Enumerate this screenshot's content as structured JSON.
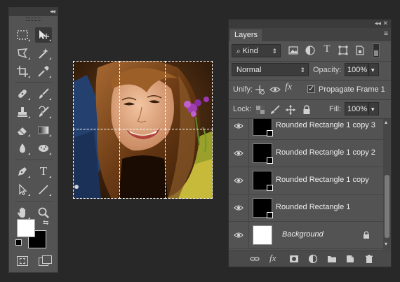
{
  "tools_panel": {
    "collapse_glyph": "◂◂",
    "close_glyph": "✕",
    "tools": [
      {
        "name": "rectangular-marquee-tool"
      },
      {
        "name": "move-tool"
      },
      {
        "name": "polygonal-lasso-tool"
      },
      {
        "name": "magic-wand-tool"
      },
      {
        "name": "crop-tool"
      },
      {
        "name": "eyedropper-tool"
      },
      {
        "name": "spot-healing-brush-tool"
      },
      {
        "name": "brush-tool"
      },
      {
        "name": "clone-stamp-tool"
      },
      {
        "name": "history-brush-tool"
      },
      {
        "name": "eraser-tool"
      },
      {
        "name": "gradient-tool"
      },
      {
        "name": "blur-tool"
      },
      {
        "name": "dodge-tool"
      },
      {
        "name": "pen-tool"
      },
      {
        "name": "type-tool",
        "glyph": "T"
      },
      {
        "name": "path-selection-tool"
      },
      {
        "name": "line-tool"
      },
      {
        "name": "hand-tool"
      },
      {
        "name": "zoom-tool"
      }
    ],
    "foreground_color": "#ffffff",
    "background_color": "#000000"
  },
  "layers_panel": {
    "title": "Layers",
    "collapse_glyph": "◂◂",
    "close_glyph": "✕",
    "menu_glyph": "≡",
    "filter_kind": {
      "icon": "search-icon",
      "value": "Kind",
      "arrows": "⇕"
    },
    "filter_type_glyph": "T",
    "blend_mode": {
      "value": "Normal",
      "arrows": "⇕"
    },
    "opacity": {
      "label": "Opacity:",
      "value": "100%",
      "arrow": "▾"
    },
    "unify_label": "Unify:",
    "fx_glyph": "fx",
    "propagate_frame": {
      "label": "Propagate Frame 1",
      "checked": true
    },
    "lock_label": "Lock:",
    "fill": {
      "label": "Fill:",
      "value": "100%",
      "arrow": "▾"
    },
    "layers": [
      {
        "name": "Rounded Rectangle 1 copy 3",
        "kind": "shape"
      },
      {
        "name": "Rounded Rectangle 1 copy 2",
        "kind": "shape"
      },
      {
        "name": "Rounded Rectangle 1 copy",
        "kind": "shape"
      },
      {
        "name": "Rounded Rectangle 1",
        "kind": "shape"
      },
      {
        "name": "Background",
        "kind": "background",
        "locked": true
      }
    ],
    "footer_fx_glyph": "fx",
    "scroll_up_glyph": "▴",
    "scroll_down_glyph": "▾"
  },
  "colors": {
    "panel_bg": "#535353",
    "app_bg": "#282828",
    "selected_tool_bg": "#383838",
    "field_bg": "#3c3c3c"
  }
}
